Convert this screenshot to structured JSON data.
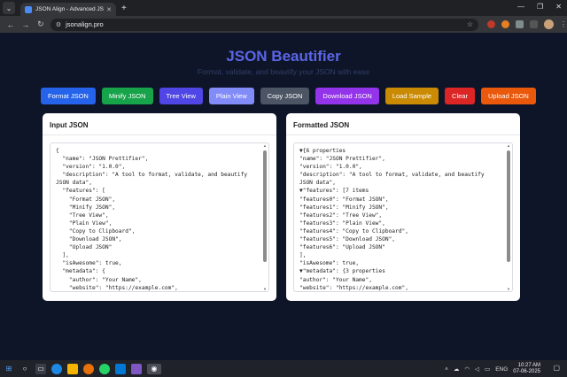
{
  "browser": {
    "tab_title": "JSON Align - Advanced JSON F",
    "tab_close": "✕",
    "new_tab": "+",
    "url": "jsonalign.pro",
    "window_controls": [
      "—",
      "❐",
      "✕"
    ]
  },
  "header": {
    "title": "JSON Beautifier",
    "subtitle": "Format, validate, and beautify your JSON with ease"
  },
  "toolbar": {
    "buttons": [
      {
        "label": "Format JSON",
        "color": "#2563eb"
      },
      {
        "label": "Minify JSON",
        "color": "#16a34a"
      },
      {
        "label": "Tree View",
        "color": "#4f46e5"
      },
      {
        "label": "Plain View",
        "color": "#818cf8"
      },
      {
        "label": "Copy JSON",
        "color": "#4b5563"
      },
      {
        "label": "Download JSON",
        "color": "#9333ea"
      },
      {
        "label": "Load Sample",
        "color": "#ca8a04"
      },
      {
        "label": "Clear",
        "color": "#dc2626"
      },
      {
        "label": "Upload JSON",
        "color": "#ea580c"
      }
    ]
  },
  "input_panel": {
    "title": "Input JSON",
    "content": "{\n  \"name\": \"JSON Prettifier\",\n  \"version\": \"1.0.0\",\n  \"description\": \"A tool to format, validate, and beautify JSON data\",\n  \"features\": [\n    \"Format JSON\",\n    \"Minify JSON\",\n    \"Tree View\",\n    \"Plain View\",\n    \"Copy to Clipboard\",\n    \"Download JSON\",\n    \"Upload JSON\"\n  ],\n  \"isAwesome\": true,\n  \"metadata\": {\n    \"author\": \"Your Name\",\n    \"website\": \"https://example.com\",\n    \"license\": \"MIT\""
  },
  "output_panel": {
    "title": "Formatted JSON",
    "content": "▼{6 properties\n\"name\": \"JSON Prettifier\",\n\"version\": \"1.0.0\",\n\"description\": \"A tool to format, validate, and beautify JSON data\",\n▼\"features\": [7 items\n\"features0\": \"Format JSON\",\n\"features1\": \"Minify JSON\",\n\"features2\": \"Tree View\",\n\"features3\": \"Plain View\",\n\"features4\": \"Copy to Clipboard\",\n\"features5\": \"Download JSON\",\n\"features6\": \"Upload JSON\"\n],\n\"isAwesome\": true,\n▼\"metadata\": {3 properties\n\"author\": \"Your Name\",\n\"website\": \"https://example.com\",\n\"license\": \"MIT\""
  },
  "taskbar": {
    "language": "ENG",
    "time": "10:27 AM",
    "date": "07-06-2025"
  }
}
